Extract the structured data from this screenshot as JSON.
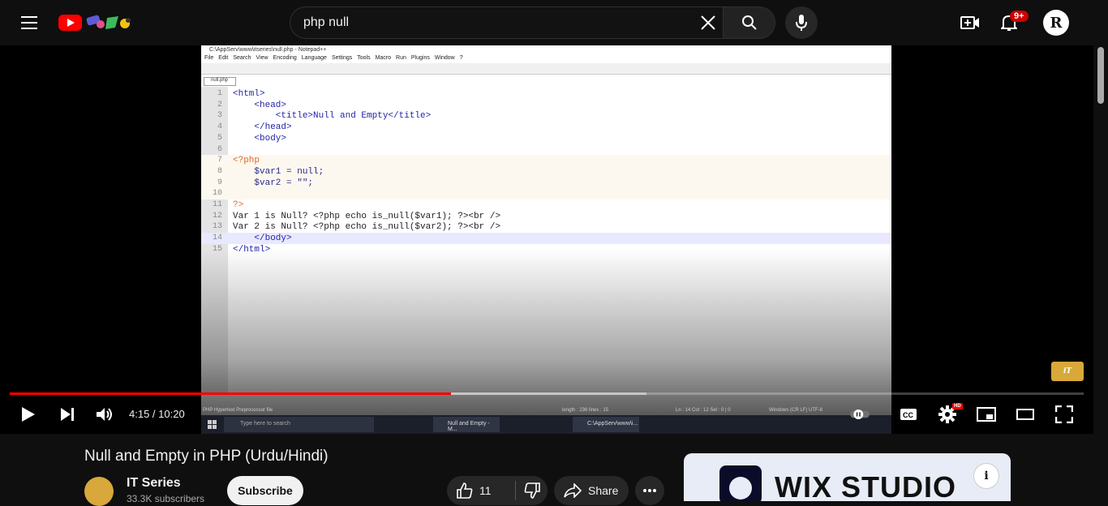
{
  "search": {
    "query": "php null"
  },
  "header": {
    "notifications_badge": "9+",
    "avatar_letter": "R"
  },
  "editor": {
    "window_title": "C:\\AppServ\\www\\itseries\\null.php - Notepad++",
    "menu": [
      "File",
      "Edit",
      "Search",
      "View",
      "Encoding",
      "Language",
      "Settings",
      "Tools",
      "Macro",
      "Run",
      "Plugins",
      "Window",
      "?"
    ],
    "tab": "null.php",
    "lines": [
      {
        "n": "1",
        "text": "<html>"
      },
      {
        "n": "2",
        "text": "    <head>"
      },
      {
        "n": "3",
        "text": "        <title>Null and Empty</title>"
      },
      {
        "n": "4",
        "text": "    </head>"
      },
      {
        "n": "5",
        "text": "    <body>"
      },
      {
        "n": "6",
        "text": ""
      },
      {
        "n": "7",
        "text": "<?php"
      },
      {
        "n": "8",
        "text": "    $var1 = null;"
      },
      {
        "n": "9",
        "text": "    $var2 = \"\";"
      },
      {
        "n": "10",
        "text": ""
      },
      {
        "n": "11",
        "text": "?>"
      },
      {
        "n": "12",
        "text": "Var 1 is Null? <?php echo is_null($var1); ?><br />"
      },
      {
        "n": "13",
        "text": "Var 2 is Null? <?php echo is_null($var2); ?><br />"
      },
      {
        "n": "14",
        "text": "    </body>"
      },
      {
        "n": "15",
        "text": "</html>"
      }
    ],
    "status_left": "PHP Hypertext Preprocessor file",
    "status_mid": "length : 236    lines : 15",
    "status_pos": "Ln : 14    Col : 12    Sel : 0 | 0",
    "status_enc": "Windows (CR LF)    UTF-8",
    "taskbar_search": "Type here to search",
    "taskbar_app1": "Null and Empty - M...",
    "taskbar_app2": "C:\\AppServ\\www\\i..."
  },
  "player": {
    "current_time": "4:15",
    "duration": "10:20",
    "progress_fraction": 0.411,
    "hd_badge": "HD",
    "watermark": "iT"
  },
  "video": {
    "title": "Null and Empty in PHP (Urdu/Hindi)",
    "channel": "IT Series",
    "subscribers": "33.3K subscribers",
    "subscribe_label": "Subscribe",
    "likes": "11",
    "share_label": "Share"
  },
  "ad": {
    "brand": "WIX STUDIO"
  }
}
